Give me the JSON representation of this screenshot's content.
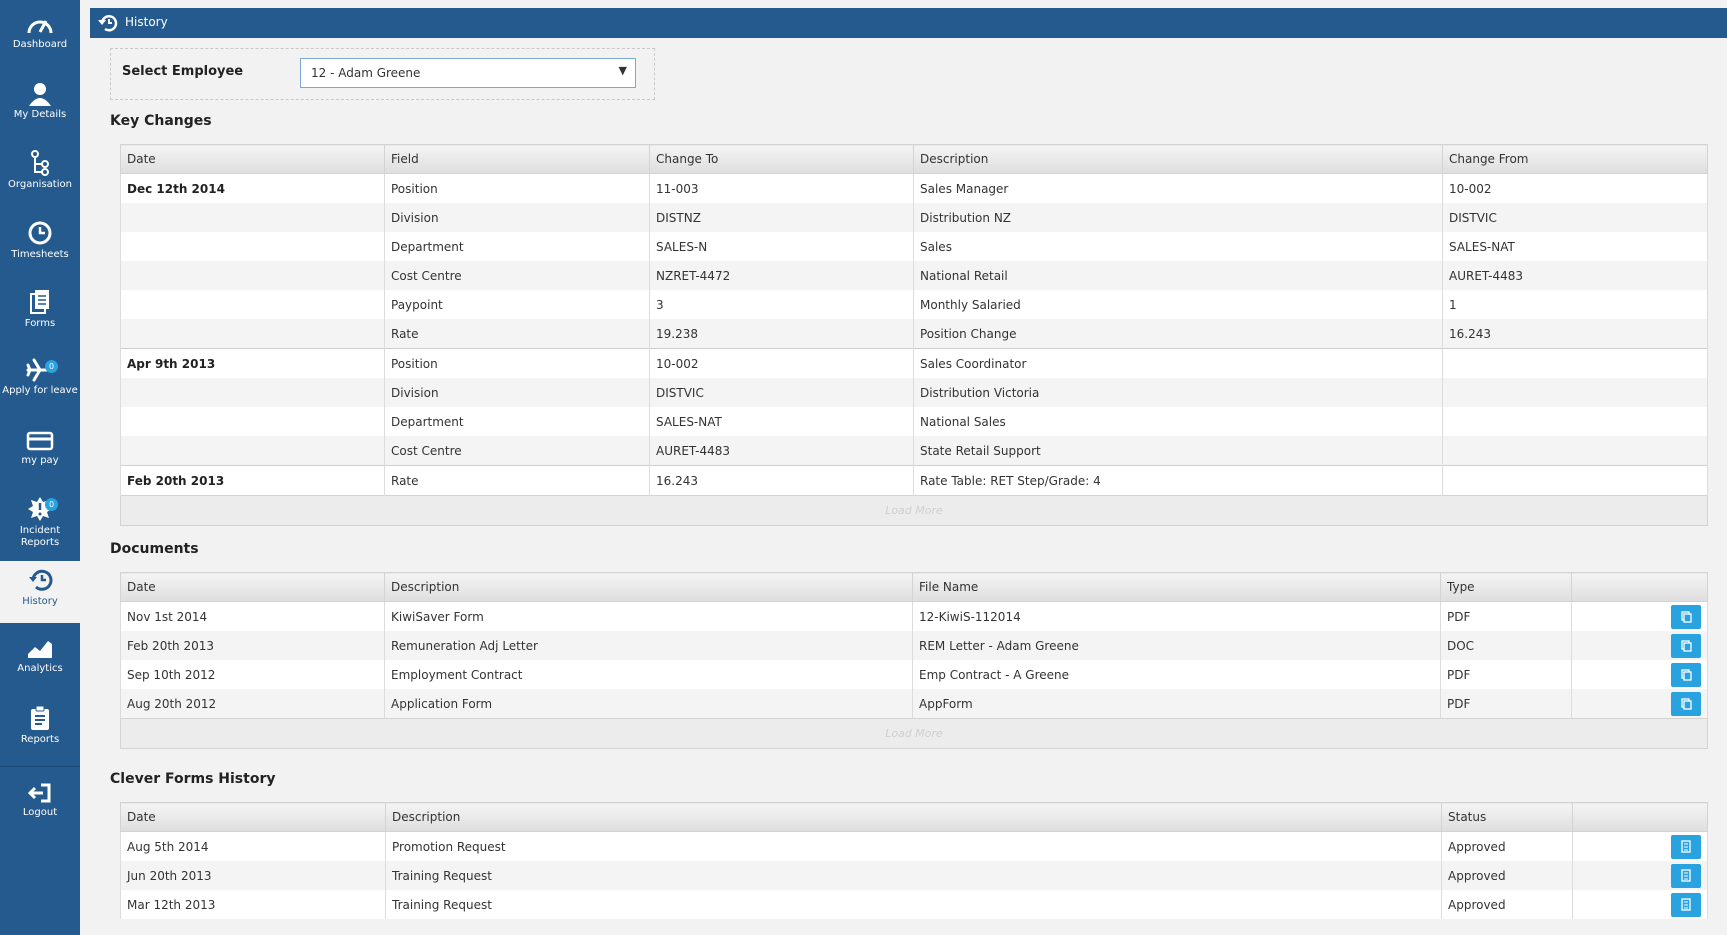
{
  "sidebar": {
    "items": [
      {
        "label": "Dashboard"
      },
      {
        "label": "My Details"
      },
      {
        "label": "Organisation"
      },
      {
        "label": "Timesheets"
      },
      {
        "label": "Forms"
      },
      {
        "label": "Apply for leave",
        "badge": "0"
      },
      {
        "label": "my pay"
      },
      {
        "label": "Incident Reports",
        "badge": "0"
      },
      {
        "label": "History"
      },
      {
        "label": "Analytics"
      },
      {
        "label": "Reports"
      },
      {
        "label": "Logout"
      }
    ]
  },
  "header": {
    "title": "History"
  },
  "employee_select": {
    "label": "Select Employee",
    "value": "12 - Adam Greene"
  },
  "key_changes": {
    "title": "Key Changes",
    "columns": [
      "Date",
      "Field",
      "Change To",
      "Description",
      "Change From"
    ],
    "rows": [
      [
        "Dec 12th 2014",
        "Position",
        "11-003",
        "Sales Manager",
        "10-002"
      ],
      [
        "",
        "Division",
        "DISTNZ",
        "Distribution NZ",
        "DISTVIC"
      ],
      [
        "",
        "Department",
        "SALES-N",
        "Sales",
        "SALES-NAT"
      ],
      [
        "",
        "Cost Centre",
        "NZRET-4472",
        "National Retail",
        "AURET-4483"
      ],
      [
        "",
        "Paypoint",
        "3",
        "Monthly Salaried",
        "1"
      ],
      [
        "",
        "Rate",
        "19.238",
        "Position Change",
        "16.243"
      ],
      [
        "Apr 9th 2013",
        "Position",
        "10-002",
        "Sales Coordinator",
        ""
      ],
      [
        "",
        "Division",
        "DISTVIC",
        "Distribution Victoria",
        ""
      ],
      [
        "",
        "Department",
        "SALES-NAT",
        "National Sales",
        ""
      ],
      [
        "",
        "Cost Centre",
        "AURET-4483",
        "State Retail Support",
        ""
      ],
      [
        "Feb 20th 2013",
        "Rate",
        "16.243",
        "Rate Table: RET Step/Grade: 4",
        ""
      ]
    ],
    "load_more": "Load More"
  },
  "documents": {
    "title": "Documents",
    "columns": [
      "Date",
      "Description",
      "File Name",
      "Type",
      ""
    ],
    "rows": [
      [
        "Nov 1st 2014",
        "KiwiSaver Form",
        "12-KiwiS-112014",
        "PDF"
      ],
      [
        "Feb 20th 2013",
        "Remuneration Adj Letter",
        "REM Letter - Adam Greene",
        "DOC"
      ],
      [
        "Sep 10th 2012",
        "Employment Contract",
        "Emp Contract - A Greene",
        "PDF"
      ],
      [
        "Aug 20th 2012",
        "Application Form",
        "AppForm",
        "PDF"
      ]
    ],
    "load_more": "Load More"
  },
  "clever_forms": {
    "title": "Clever Forms History",
    "columns": [
      "Date",
      "Description",
      "Status",
      ""
    ],
    "rows": [
      [
        "Aug 5th 2014",
        "Promotion Request",
        "Approved"
      ],
      [
        "Jun 20th 2013",
        "Training Request",
        "Approved"
      ],
      [
        "Mar 12th 2013",
        "Training Request",
        "Approved"
      ]
    ]
  }
}
